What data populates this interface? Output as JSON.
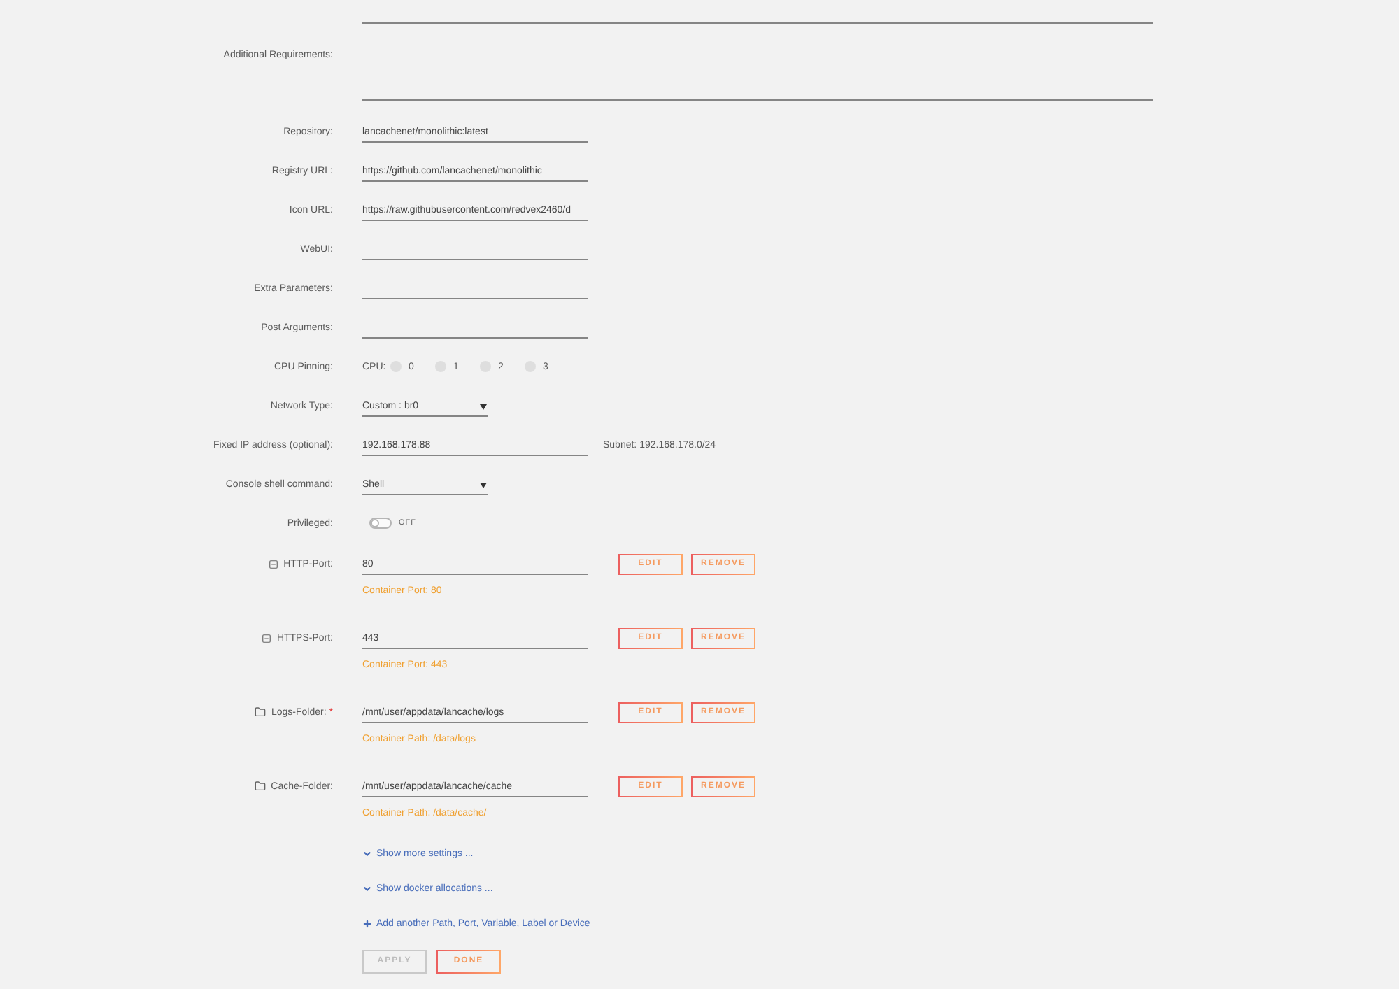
{
  "settings": [
    {
      "kind": "textarea"
    },
    {
      "kind": "textarea",
      "label": "Additional Requirements:"
    },
    {
      "kind": "text",
      "label": "Repository:",
      "value": "lancachenet/monolithic:latest"
    },
    {
      "kind": "text",
      "label": "Registry URL:",
      "value": "https://github.com/lancachenet/monolithic"
    },
    {
      "kind": "text",
      "label": "Icon URL:",
      "value": "https://raw.githubusercontent.com/redvex2460/d"
    },
    {
      "kind": "text",
      "label": "WebUI:"
    },
    {
      "kind": "text",
      "label": "Extra Parameters:"
    },
    {
      "kind": "text",
      "label": "Post Arguments:"
    },
    {
      "kind": "cpu",
      "label": "CPU Pinning:",
      "prefix": "CPU:",
      "cpus": [
        {
          "label": "0",
          "checked": false
        },
        {
          "label": "1",
          "checked": false
        },
        {
          "label": "2",
          "checked": false
        },
        {
          "label": "3",
          "checked": false
        }
      ]
    },
    {
      "kind": "select",
      "label": "Network Type:",
      "value": "Custom : br0"
    },
    {
      "kind": "text",
      "label": "Fixed IP address (optional):",
      "value": "192.168.178.88",
      "note": "Subnet: 192.168.178.0/24"
    },
    {
      "kind": "select",
      "label": "Console shell command:",
      "value": "Shell"
    },
    {
      "kind": "toggle",
      "label": "Privileged:",
      "on": false,
      "state_text": "OFF"
    }
  ],
  "mappings": [
    {
      "kind": "port",
      "label": "HTTP-Port:",
      "value": "80",
      "hint": "Container Port: 80",
      "actions": [
        "EDIT",
        "REMOVE"
      ]
    },
    {
      "kind": "port",
      "label": "HTTPS-Port:",
      "value": "443",
      "hint": "Container Port: 443",
      "actions": [
        "EDIT",
        "REMOVE"
      ]
    },
    {
      "kind": "path",
      "label": "Logs-Folder:",
      "required_mark": "*",
      "value": "/mnt/user/appdata/lancache/logs",
      "hint": "Container Path: /data/logs",
      "actions": [
        "EDIT",
        "REMOVE"
      ]
    },
    {
      "kind": "path",
      "label": "Cache-Folder:",
      "value": "/mnt/user/appdata/lancache/cache",
      "hint": "Container Path: /data/cache/",
      "actions": [
        "EDIT",
        "REMOVE"
      ]
    }
  ],
  "links": [
    {
      "kind": "expand",
      "label": "Show more settings ..."
    },
    {
      "kind": "expand",
      "label": "Show docker allocations ..."
    },
    {
      "kind": "add",
      "label": "Add another Path, Port, Variable, Label or Device"
    }
  ],
  "buttons": [
    {
      "label": "APPLY",
      "disabled": true
    },
    {
      "label": "DONE",
      "disabled": false
    }
  ]
}
